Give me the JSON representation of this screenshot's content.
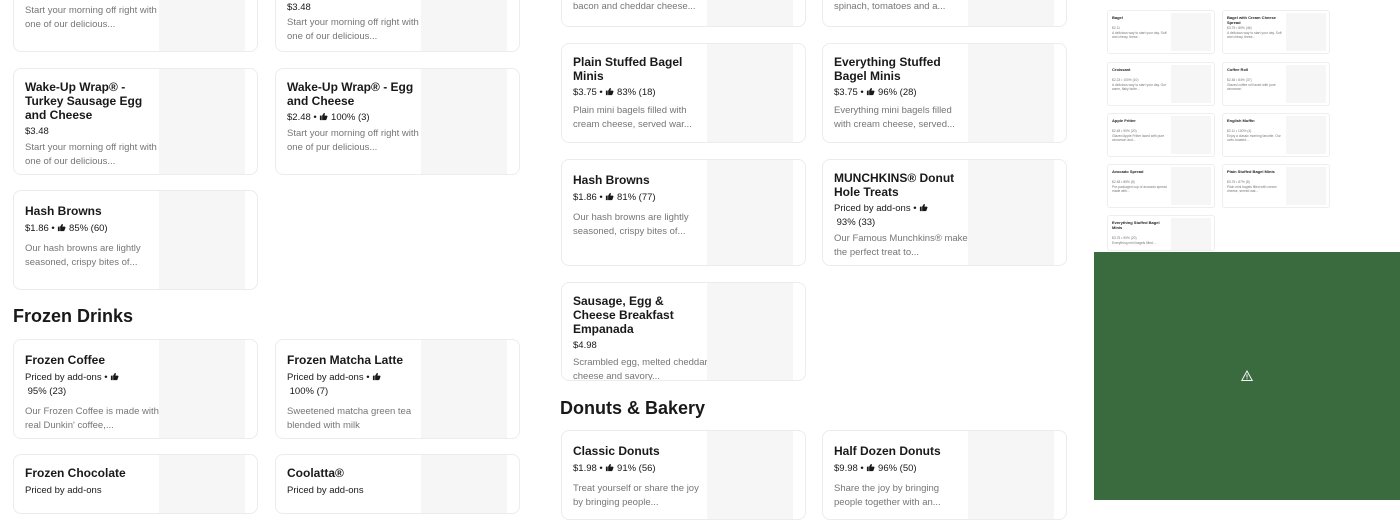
{
  "col1": {
    "top_card": {
      "desc": "Start your morning off right with one of our delicious..."
    },
    "cards": [
      {
        "name": "Wake-Up Wrap® - Turkey Sausage Egg and Cheese",
        "price": "$3.48",
        "rating": "",
        "desc": "Start your morning off right with one of our delicious..."
      },
      {
        "name": "Hash Browns",
        "price": "$1.86 •",
        "rating": "85% (60)",
        "desc": "Our hash browns are lightly seasoned, crispy bites of..."
      }
    ]
  },
  "col2": {
    "top_card": {
      "price": "$3.48",
      "desc": "Start your morning off right with one of our delicious..."
    },
    "cards": [
      {
        "name": "Wake-Up Wrap® - Egg and Cheese",
        "price": "$2.48 •",
        "rating": "100% (3)",
        "desc": "Start your morning off right with one of pur delicious..."
      }
    ]
  },
  "frozen_drinks": {
    "title": "Frozen Drinks",
    "cards": [
      {
        "name": "Frozen Coffee",
        "price": "Priced by add-ons •",
        "rating": "95% (23)",
        "desc": "Our Frozen Coffee is made with real Dunkin' coffee,..."
      },
      {
        "name": "Frozen Matcha Latte",
        "price": "Priced by add-ons •",
        "rating": "100% (7)",
        "desc": "Sweetened matcha green tea blended with milk"
      },
      {
        "name": "Frozen Chocolate",
        "price": "Priced by add-ons"
      },
      {
        "name": "Coolatta®",
        "price": "Priced by add-ons"
      }
    ]
  },
  "col3": {
    "top_card": {
      "desc": "bacon and cheddar cheese..."
    },
    "cards": [
      {
        "name": "Plain Stuffed Bagel Minis",
        "price": "$3.75 •",
        "rating": "83% (18)",
        "desc": "Plain mini bagels filled with cream cheese, served war..."
      },
      {
        "name": "Hash Browns",
        "price": "$1.86 •",
        "rating": "81% (77)",
        "desc": "Our hash browns are lightly seasoned, crispy bites of..."
      },
      {
        "name": "Sausage, Egg & Cheese Breakfast Empanada",
        "price": "$4.98",
        "rating": "",
        "desc": "Scrambled egg, melted cheddar cheese and savory..."
      }
    ]
  },
  "col4": {
    "top_card": {
      "desc": "spinach, tomatoes and a..."
    },
    "cards": [
      {
        "name": "Everything Stuffed Bagel Minis",
        "price": "$3.75 •",
        "rating": "96% (28)",
        "desc": "Everything mini bagels filled with cream cheese, served..."
      },
      {
        "name": "MUNCHKINS® Donut Hole Treats",
        "price": "Priced by add-ons •",
        "rating": "93% (33)",
        "desc": "Our Famous Munchkins® make the perfect treat to..."
      }
    ]
  },
  "donuts": {
    "title": "Donuts & Bakery",
    "cards": [
      {
        "name": "Classic Donuts",
        "price": "$1.98 •",
        "rating": "91% (56)",
        "desc": "Treat yourself or share the joy by bringing people..."
      },
      {
        "name": "Half Dozen Donuts",
        "price": "$9.98 •",
        "rating": "96% (50)",
        "desc": "Share the joy by bringing people together with an..."
      }
    ]
  },
  "preview": {
    "items": [
      {
        "name": "Bagel",
        "meta": "$2.11",
        "desc": "A delicious way to start your day. Soft and chewy, these..."
      },
      {
        "name": "Bagel with Cream Cheese Spread",
        "meta": "$3.75 • 85% (46)",
        "desc": "A delicious way to start your day. Soft and chewy, these..."
      },
      {
        "name": "Croissant",
        "meta": "$2.23 • 100% (10)",
        "desc": "A delicious way to start your day. Our warm, flaky butte..."
      },
      {
        "name": "Coffee Roll",
        "meta": "$2.48 • 84% (37)",
        "desc": "Glazed coffee roll laced with pure cinnamon"
      },
      {
        "name": "Apple Fritter",
        "meta": "$2.48 • 90% (20)",
        "desc": "Glazed Apple Fritter laced with pure cinnamon and..."
      },
      {
        "name": "English Muffin",
        "meta": "$2.11 • 100% (4)",
        "desc": "Enjoy a classic morning favorite. Our oven-toasted..."
      },
      {
        "name": "Avocado Spread",
        "meta": "$2.48 • 85% (8)",
        "desc": "Pre-packaged cup of avocado spread made with..."
      },
      {
        "name": "Plain Stuffed Bagel Minis",
        "meta": "$3.75 • 87% (8)",
        "desc": "Plain mini bagels filled with cream cheese, served war..."
      },
      {
        "name": "Everything Stuffed Bagel Minis",
        "meta": "$3.75 • 90% (20)",
        "desc": "Everything mini bagels filled..."
      }
    ]
  },
  "overlay": {
    "color": "#3a6b3f",
    "icon": "warning-icon"
  }
}
